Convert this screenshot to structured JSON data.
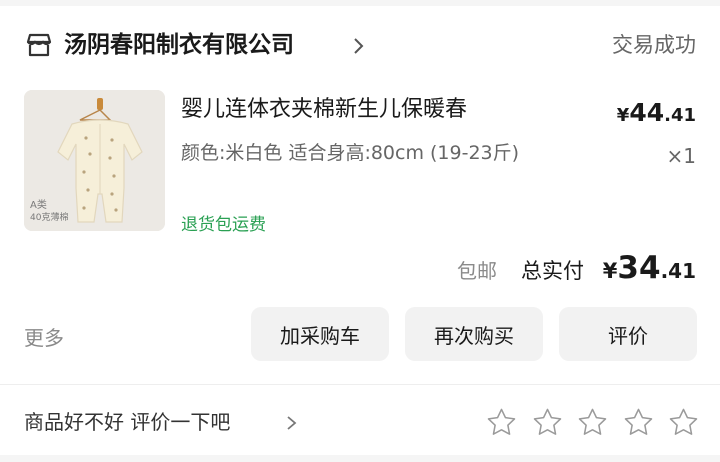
{
  "store": {
    "name": "汤阴春阳制衣有限公司",
    "icon": "store-icon"
  },
  "order": {
    "status": "交易成功"
  },
  "product": {
    "title": "婴儿连体衣夹棉新生儿保暖春",
    "price_currency": "¥",
    "price_int": "44",
    "price_dec": ".41",
    "spec": "颜色:米白色 适合身高:80cm (19-23斤)",
    "quantity": "×1",
    "service": "退货包运费",
    "image_label_1": "A类",
    "image_label_2": "40克薄棉"
  },
  "totals": {
    "shipping": "包邮",
    "label": "总实付",
    "currency": "¥",
    "int": "34",
    "dec": ".41"
  },
  "actions": {
    "more": "更多",
    "add_cart": "加采购车",
    "buy_again": "再次购买",
    "review": "评价"
  },
  "rating": {
    "prompt": "商品好不好 评价一下吧",
    "stars_total": 5,
    "stars_filled": 0
  }
}
